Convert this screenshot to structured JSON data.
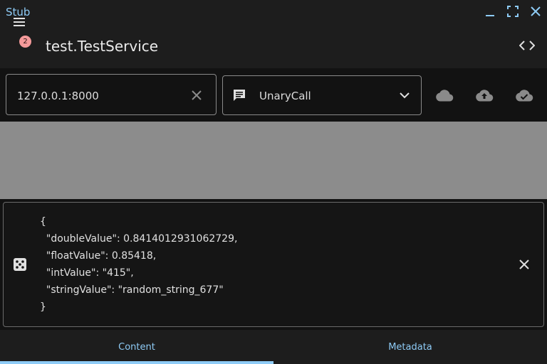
{
  "window": {
    "title": "Stub"
  },
  "appbar": {
    "notification_count": "2",
    "service_title": "test.TestService"
  },
  "toolbar": {
    "address": "127.0.0.1:8000",
    "method": "UnaryCall",
    "icons": [
      "cloud-icon",
      "cloud-upload-icon",
      "cloud-done-icon"
    ]
  },
  "content": {
    "json_lines": [
      "{",
      "  \"doubleValue\": 0.8414012931062729,",
      "  \"floatValue\": 0.85418,",
      "  \"intValue\": \"415\",",
      "  \"stringValue\": \"random_string_677\"",
      "}"
    ]
  },
  "tabs": [
    {
      "label": "Content",
      "active": true
    },
    {
      "label": "Metadata",
      "active": false
    }
  ],
  "colors": {
    "accent": "#8ecbf6",
    "badge": "#f49a9a",
    "surface": "#1d1d1d",
    "background": "#121212",
    "pane": "#8c8c8c"
  }
}
